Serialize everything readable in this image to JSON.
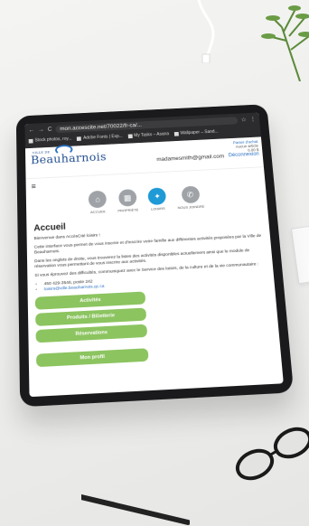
{
  "browser": {
    "url": "mon.accescite.net/70022/fr-ca/...",
    "bookmarks": [
      "Stock photos, roy...",
      "Adobe Fonts | Exp...",
      "My Tasks – Asana",
      "Wallpaper – Sand..."
    ]
  },
  "site": {
    "logo_small": "VILLE DE",
    "logo": "Beauharnois",
    "user_email": "madamesmith@gmail.com",
    "logout": "Déconnexion",
    "cart_title": "Panier d'achat",
    "cart_count": "Aucun article",
    "cart_total": "0.00 $"
  },
  "nav": {
    "items": [
      {
        "label": "ACCUEIL",
        "icon": "home-icon"
      },
      {
        "label": "PROPRIÉTÉ",
        "icon": "house-icon"
      },
      {
        "label": "LOISIRS",
        "icon": "leisure-icon"
      },
      {
        "label": "NOUS JOINDRE",
        "icon": "phone-icon"
      }
    ]
  },
  "main": {
    "title": "Accueil",
    "p1": "Bienvenue dans AccèsCité loisirs !",
    "p2": "Cette interface vous permet de vous inscrire et d'inscrire votre famille aux différentes activités proposées par la Ville de Beauharnois.",
    "p3": "Dans les onglets de droite, vous trouverez la listes des activités disponibles actuellement ainsi que le module de réservation vous permettant de vous inscrire aux activités.",
    "p4": "Si vous éprouvez des difficultés, communiquez avec le Service des loisirs, de la culture et de la vie communautaire :",
    "phone": "450 429-3546, poste 242",
    "email": "loisirs@ville.beauharnois.qc.ca",
    "btn_activites": "Activités",
    "btn_produits": "Produits / Billetterie",
    "btn_reservations": "Réservations",
    "btn_profil": "Mon profil"
  },
  "colors": {
    "accent": "#1e9ad6",
    "button": "#8cc460",
    "brand": "#1f4c8f"
  }
}
